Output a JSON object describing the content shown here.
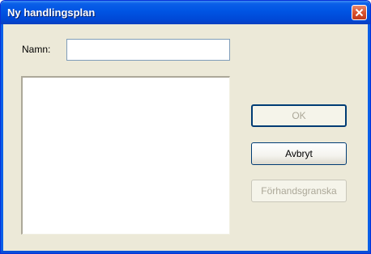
{
  "window": {
    "title": "Ny handlingsplan"
  },
  "form": {
    "name_label": "Namn:",
    "name_value": "",
    "name_placeholder": ""
  },
  "buttons": {
    "ok_label": "OK",
    "cancel_label": "Avbryt",
    "preview_label": "Förhandsgranska"
  },
  "colors": {
    "titlebar": "#0054e3",
    "dialog_bg": "#ece9d8",
    "close_button": "#d9532e",
    "disabled_text": "#aca899"
  }
}
